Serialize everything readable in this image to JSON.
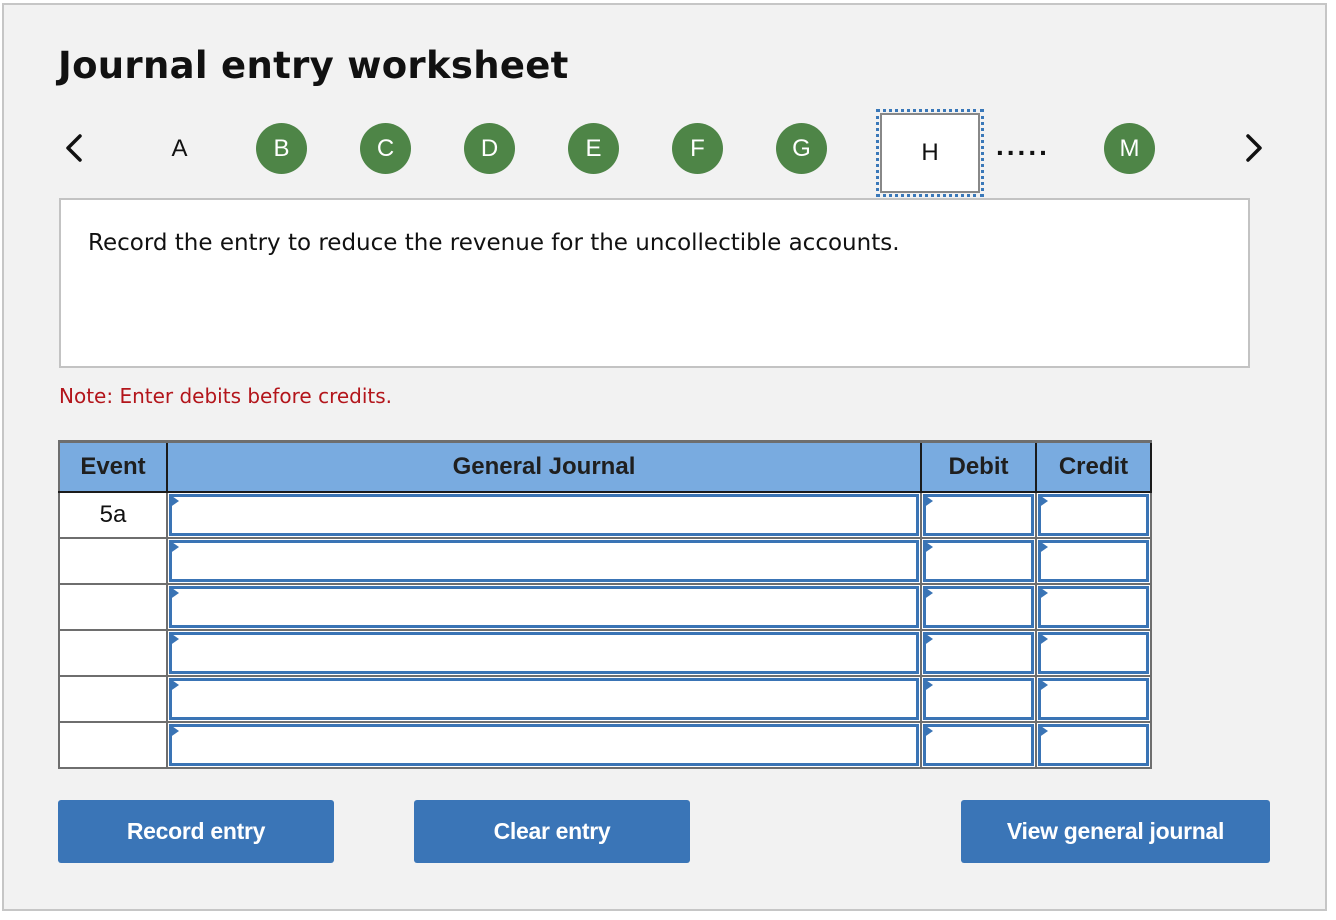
{
  "title": "Journal entry worksheet",
  "navigation": {
    "prev_icon": "chevron-left-icon",
    "next_icon": "chevron-right-icon",
    "ellipsis": ".....",
    "steps": [
      {
        "label": "A",
        "state": "plain"
      },
      {
        "label": "B",
        "state": "done"
      },
      {
        "label": "C",
        "state": "done"
      },
      {
        "label": "D",
        "state": "done"
      },
      {
        "label": "E",
        "state": "done"
      },
      {
        "label": "F",
        "state": "done"
      },
      {
        "label": "G",
        "state": "done"
      },
      {
        "label": "H",
        "state": "current"
      },
      {
        "label": "M",
        "state": "done"
      }
    ]
  },
  "prompt": "Record the entry to reduce the revenue for the uncollectible accounts.",
  "note": "Note: Enter debits before credits.",
  "table": {
    "headers": {
      "event": "Event",
      "general_journal": "General Journal",
      "debit": "Debit",
      "credit": "Credit"
    },
    "rows": [
      {
        "event": "5a",
        "account": "",
        "debit": "",
        "credit": ""
      },
      {
        "event": "",
        "account": "",
        "debit": "",
        "credit": ""
      },
      {
        "event": "",
        "account": "",
        "debit": "",
        "credit": ""
      },
      {
        "event": "",
        "account": "",
        "debit": "",
        "credit": ""
      },
      {
        "event": "",
        "account": "",
        "debit": "",
        "credit": ""
      },
      {
        "event": "",
        "account": "",
        "debit": "",
        "credit": ""
      }
    ]
  },
  "buttons": {
    "record": "Record entry",
    "clear": "Clear entry",
    "view": "View general journal"
  },
  "colors": {
    "step_done": "#4e8547",
    "header_bg": "#79abe0",
    "button_bg": "#3a75b7",
    "note_text": "#b3151b"
  }
}
